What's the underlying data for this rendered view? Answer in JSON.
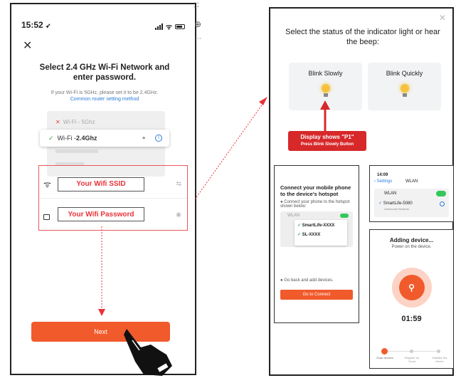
{
  "left_phone": {
    "time": "15:52",
    "title": "Select 2.4 GHz Wi-Fi Network and enter password.",
    "hint": "If your Wi-Fi is 5GHz, please set it to be 2.4GHz.",
    "hint_link": "Common router setting method",
    "networks": {
      "blocked": "Wi-Fi - 5Ghz",
      "selected_prefix": "Wi-Fi - ",
      "selected_band": "2.4Ghz"
    },
    "ssid_label": "Your Wifi SSID",
    "password_label": "Your Wifi Password",
    "next_label": "Next"
  },
  "right": {
    "title": "Select the status of the indicator light or hear the beep:",
    "blink_slowly": "Blink Slowly",
    "blink_quickly": "Blink Quickly",
    "callout_main": "Display shows \"P1\"",
    "callout_sub": "Press Blink Slowly Button",
    "hotspot": {
      "title": "Connect your mobile phone to the device's hotspot",
      "step1": "Connect your phone to the hotspot shown below:",
      "header": "WLAN",
      "net1": "SmartLife-XXXX",
      "net2": "SL-XXXX",
      "step2": "Go back and add devices.",
      "button": "Go to Connect"
    },
    "settings": {
      "time": "14:09",
      "back": "Settings",
      "header": "WLAN",
      "wlan_label": "WLAN",
      "network": "SmartLife-5080",
      "network_sub": "Unsecured Network"
    },
    "adding": {
      "title": "Adding device...",
      "subtitle": "Power on the device.",
      "timer": "01:59",
      "steps": [
        "Scan devices",
        "Register on Cloud",
        "Initialize the device"
      ]
    }
  },
  "colors": {
    "accent": "#f15a2b",
    "annotation_red": "#d7282a",
    "link": "#2a7bd6",
    "toggle_green": "#34c759"
  }
}
